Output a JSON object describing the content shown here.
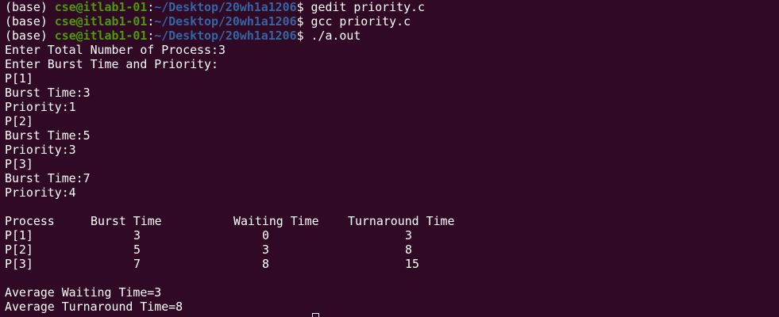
{
  "prompts": [
    {
      "env": "(base) ",
      "user_host": "cse@itlab1-01",
      "sep": ":",
      "path": "~/Desktop/20wh1a1206",
      "symbol": "$ ",
      "command": "gedit priority.c"
    },
    {
      "env": "(base) ",
      "user_host": "cse@itlab1-01",
      "sep": ":",
      "path": "~/Desktop/20wh1a1206",
      "symbol": "$ ",
      "command": "gcc priority.c"
    },
    {
      "env": "(base) ",
      "user_host": "cse@itlab1-01",
      "sep": ":",
      "path": "~/Desktop/20wh1a1206",
      "symbol": "$ ",
      "command": "./a.out"
    }
  ],
  "output_lines": [
    "Enter Total Number of Process:3",
    "Enter Burst Time and Priority:",
    "P[1]",
    "Burst Time:3",
    "Priority:1",
    "P[2]",
    "Burst Time:5",
    "Priority:3",
    "P[3]",
    "Burst Time:7",
    "Priority:4"
  ],
  "table": {
    "headers": [
      "Process",
      "Burst Time",
      "Waiting Time",
      "Turnaround Time"
    ],
    "rows": [
      [
        "P[1]",
        "3",
        "0",
        "3"
      ],
      [
        "P[2]",
        "5",
        "3",
        "8"
      ],
      [
        "P[3]",
        "7",
        "8",
        "15"
      ]
    ]
  },
  "averages": {
    "waiting": "Average Waiting Time=3",
    "turnaround": "Average Turnaround Time=8"
  },
  "colors": {
    "background": "#300a24",
    "text": "#ffffff",
    "user_host": "#4e9a06",
    "path": "#3465a4"
  }
}
